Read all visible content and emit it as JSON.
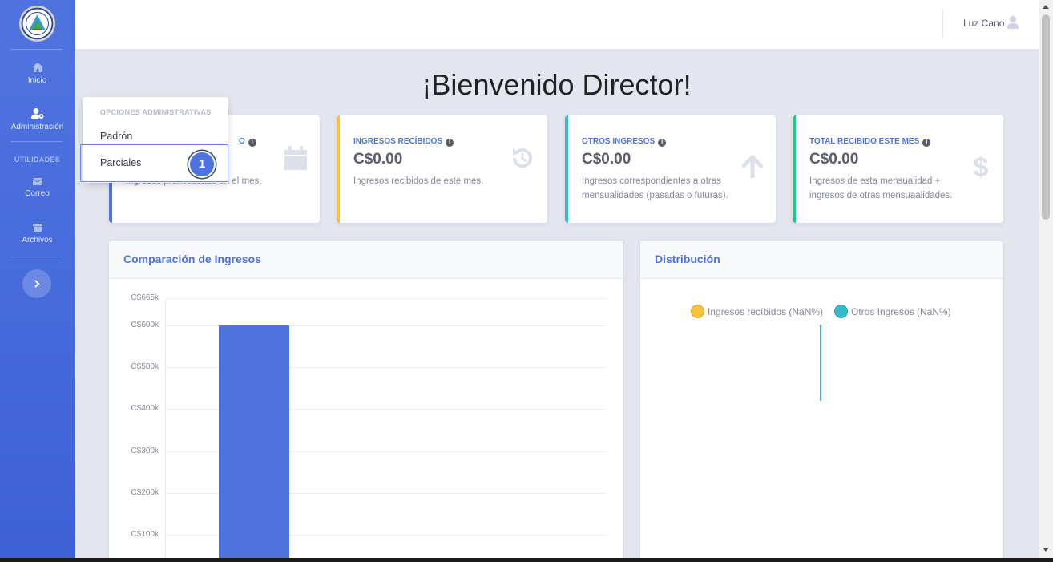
{
  "sidebar": {
    "items": [
      {
        "label": "Inicio",
        "icon": "home-icon"
      },
      {
        "label": "Administración",
        "icon": "user-gear-icon"
      },
      {
        "label": "Correo",
        "icon": "envelope-icon"
      },
      {
        "label": "Archivos",
        "icon": "archive-icon"
      }
    ],
    "heading_utilidades": "UTILIDADES"
  },
  "topbar": {
    "user_name": "Luz Cano"
  },
  "main": {
    "welcome": "¡Bienvenido Director!",
    "cards": [
      {
        "label": "O",
        "value": "",
        "desc": "Ingresos pronosticado en el mes.",
        "color": "#4e73df",
        "icon": "calendar-icon"
      },
      {
        "label": "INGRESOS RECÍBIDOS",
        "value": "C$0.00",
        "desc": "Ingresos recibidos de este mes.",
        "color": "#f6c23e",
        "icon": "history-icon"
      },
      {
        "label": "OTROS INGRESOS",
        "value": "C$0.00",
        "desc": "Ingresos correspondientes a otras mensualidades (pasadas o futuras).",
        "color": "#36b9cc",
        "icon": "arrow-up-icon"
      },
      {
        "label": "TOTAL RECIBIDO ESTE MES",
        "value": "C$0.00",
        "desc": "Ingresos de esta mensualidad + ingresos de otras mensuaalidades.",
        "color": "#1cc88a",
        "icon": "dollar-icon"
      }
    ],
    "comparison_title": "Comparación de Ingresos",
    "distribution_title": "Distribución"
  },
  "dropdown": {
    "header": "OPCIONES ADMINISTRATIVAS",
    "items": [
      "Padrón",
      "Parciales"
    ],
    "badge": "1"
  },
  "chart_data": [
    {
      "type": "bar",
      "title": "Comparación de Ingresos",
      "categories": [
        ""
      ],
      "values": [
        600000
      ],
      "ylim": [
        0,
        665000
      ],
      "tick_labels": [
        "C$665k",
        "C$600k",
        "C$500k",
        "C$400k",
        "C$300k",
        "C$200k",
        "C$100k"
      ],
      "color": "#4e73df"
    },
    {
      "type": "pie",
      "title": "Distribución",
      "series": [
        {
          "name": "Ingresos recíbidos  (NaN%)",
          "color": "#f6c23e"
        },
        {
          "name": "Otros Ingresos (NaN%)",
          "color": "#36b9cc"
        }
      ],
      "legend": "top"
    }
  ]
}
